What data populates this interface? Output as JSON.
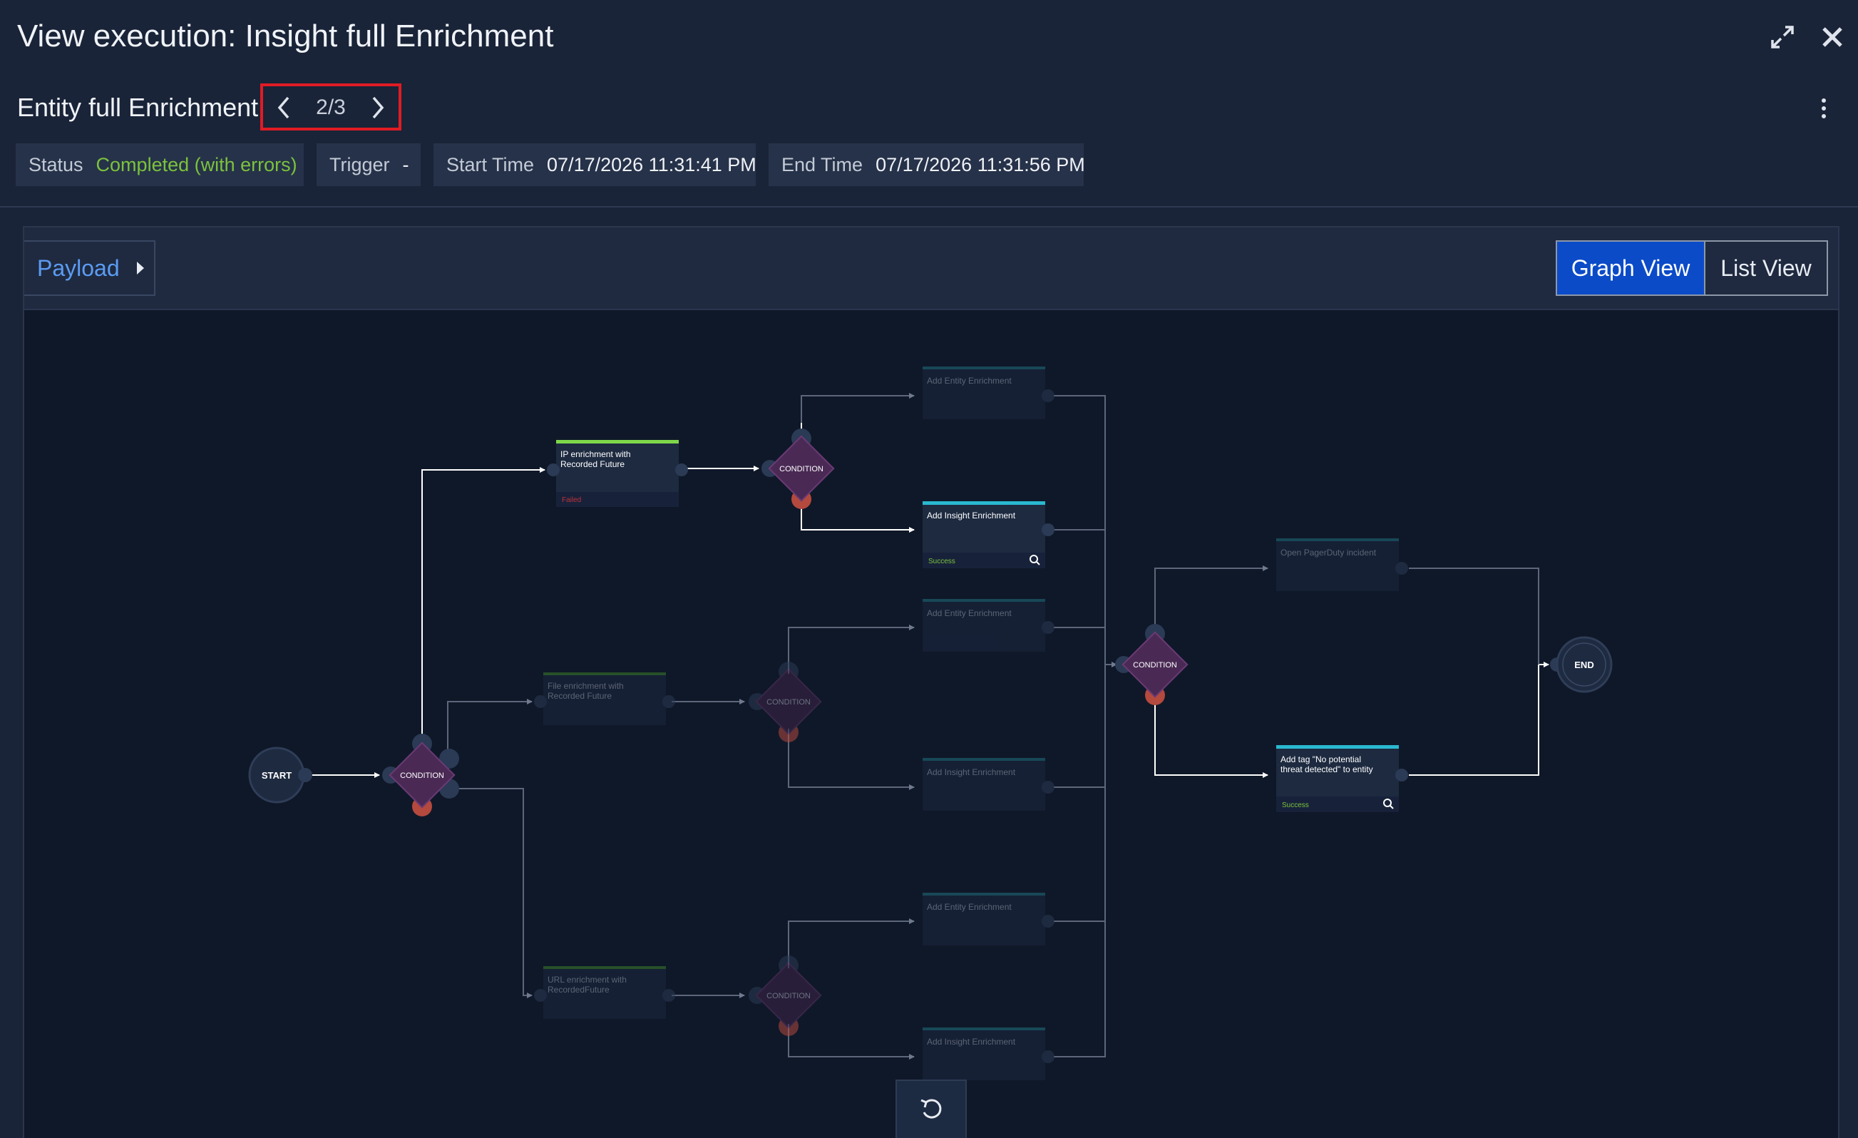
{
  "header": {
    "title": "View execution: Insight full Enrichment",
    "expand_icon": "expand-arrows-icon",
    "close_icon": "close-icon"
  },
  "subheader": {
    "entity_title": "Entity full Enrichment",
    "pager": {
      "prev_icon": "chevron-left-icon",
      "count": "2/3",
      "next_icon": "chevron-right-icon"
    },
    "more_icon": "kebab-menu-icon"
  },
  "meta": {
    "status_label": "Status",
    "status_value": "Completed (with errors)",
    "trigger_label": "Trigger",
    "trigger_value": "-",
    "start_label": "Start Time",
    "start_value": "07/17/2026 11:31:41 PM",
    "end_label": "End Time",
    "end_value": "07/17/2026 11:31:56 PM"
  },
  "toolbar": {
    "payload_label": "Payload",
    "graph_view_label": "Graph View",
    "list_view_label": "List View",
    "active_view": "Graph View"
  },
  "graph": {
    "start_label": "START",
    "end_label": "END",
    "condition_label": "CONDITION",
    "nodes": {
      "ip": {
        "line1": "IP enrichment with",
        "line2": "Recorded Future",
        "status": "Failed"
      },
      "file": {
        "line1": "File enrichment with",
        "line2": "Recorded Future"
      },
      "url": {
        "line1": "URL enrichment with",
        "line2": "RecordedFuture"
      },
      "ip_entity": {
        "line1": "Add Entity Enrichment"
      },
      "ip_insight": {
        "line1": "Add Insight Enrichment",
        "status": "Success"
      },
      "file_entity": {
        "line1": "Add Entity Enrichment"
      },
      "file_insight": {
        "line1": "Add Insight Enrichment"
      },
      "url_entity": {
        "line1": "Add Entity Enrichment"
      },
      "url_insight": {
        "line1": "Add Insight Enrichment"
      },
      "pagerduty": {
        "line1": "Open PagerDuty incident"
      },
      "tag": {
        "line1": "Add tag \"No potential",
        "line2": "threat detected\" to entity",
        "status": "Success"
      }
    }
  },
  "colors": {
    "accent": "#0b4bc8",
    "success": "#7cc23d",
    "failed": "#e0333f",
    "highlight_border": "#e01b24"
  },
  "reset_icon": "reset-zoom-icon"
}
